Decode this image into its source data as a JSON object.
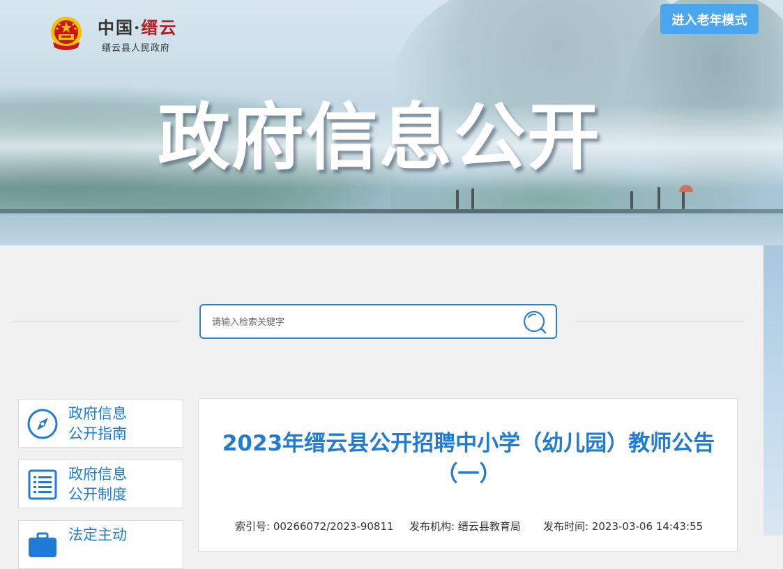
{
  "header": {
    "logo_prefix": "中国·",
    "logo_highlight": "缙云",
    "logo_sub": "缙云县人民政府",
    "elder_mode_label": "进入老年模式",
    "banner_title": "政府信息公开"
  },
  "search": {
    "placeholder": "请输入检索关键字"
  },
  "sidebar": {
    "items": [
      {
        "line1": "政府信息",
        "line2": "公开指南",
        "icon": "compass-icon"
      },
      {
        "line1": "政府信息",
        "line2": "公开制度",
        "icon": "document-list-icon"
      },
      {
        "line1": "法定主动",
        "line2": "",
        "icon": "briefcase-icon"
      }
    ]
  },
  "article": {
    "title_line1": "2023年缙云县公开招聘中小学（幼儿园）教师公告",
    "title_line2": "（一）",
    "meta": {
      "index_label": "索引号:",
      "index_value": "00266072/2023-90811",
      "org_label": "发布机构:",
      "org_value": "缙云县教育局",
      "time_label": "发布时间:",
      "time_value": "2023-03-06 14:43:55"
    }
  },
  "colors": {
    "accent_blue": "#1f7bd6",
    "button_blue": "#4aa6ef",
    "emblem_red": "#c8161d",
    "emblem_gold": "#f2c200"
  }
}
